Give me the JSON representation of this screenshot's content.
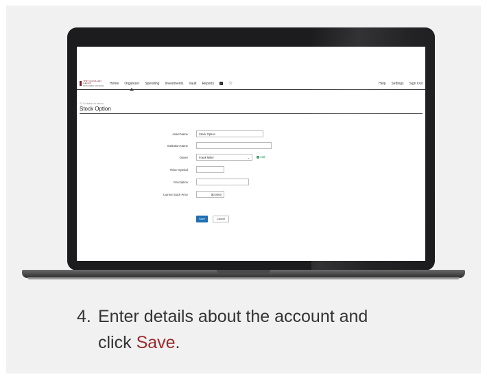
{
  "caption": {
    "step_number": "4.",
    "line1": "Enter details about the account and",
    "line2_prefix": "click ",
    "line2_accent": "Save",
    "line2_suffix": ".",
    "accent_color": "#9b2a2c"
  },
  "app": {
    "logo_text": "THE STANDARD GROUP",
    "logo_subtext": "INVESTMENT ADVISORS",
    "nav": [
      "Home",
      "Organizer",
      "Spending",
      "Investments",
      "Vault",
      "Reports"
    ],
    "active_nav": "Organizer",
    "nav_icons": [
      "checkbox-icon",
      "star-icon"
    ],
    "right_nav": [
      "Help",
      "Settings",
      "Sign Out"
    ],
    "back_link": "Go back to menu",
    "page_title": "Stock Option",
    "form": {
      "asset_name_label": "Asset Name",
      "asset_name_value": "Stock Option",
      "institution_name_label": "Institution Name",
      "institution_name_value": "",
      "owner_label": "Owner",
      "owner_value": "Frank Miller",
      "add_label": "Add",
      "ticker_symbol_label": "Ticker Symbol",
      "ticker_symbol_value": "",
      "description_label": "Description",
      "description_value": "",
      "current_stock_price_label": "Current Stock Price",
      "current_stock_price_value": "$0.0000",
      "save_label": "Save",
      "cancel_label": "Cancel"
    },
    "brand_color": "#7a1f2b",
    "primary_button_color": "#1f6fb2"
  }
}
